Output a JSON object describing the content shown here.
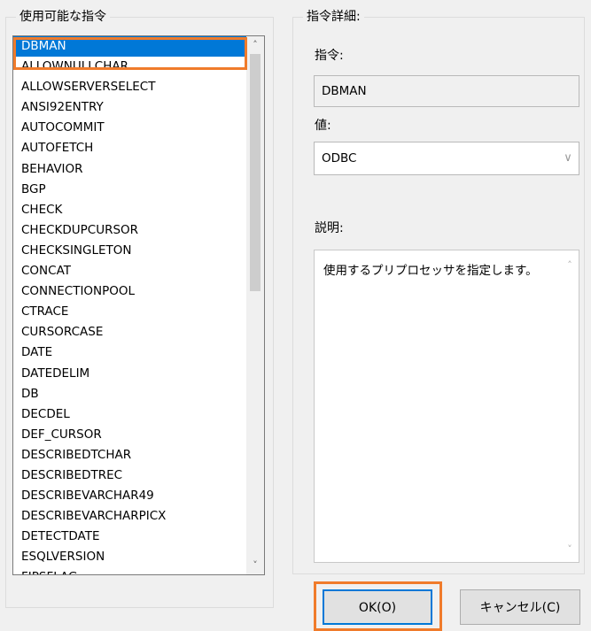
{
  "left_group": {
    "title": "使用可能な指令",
    "items": [
      "DBMAN",
      "ALLOWNULLCHAR",
      "ALLOWSERVERSELECT",
      "ANSI92ENTRY",
      "AUTOCOMMIT",
      "AUTOFETCH",
      "BEHAVIOR",
      "BGP",
      "CHECK",
      "CHECKDUPCURSOR",
      "CHECKSINGLETON",
      "CONCAT",
      "CONNECTIONPOOL",
      "CTRACE",
      "CURSORCASE",
      "DATE",
      "DATEDELIM",
      "DB",
      "DECDEL",
      "DEF_CURSOR",
      "DESCRIBEDTCHAR",
      "DESCRIBEDTREC",
      "DESCRIBEVARCHAR49",
      "DESCRIBEVARCHARPICX",
      "DETECTDATE",
      "ESQLVERSION",
      "FIPSFLAG"
    ],
    "scroll_up_icon": "chevron-up-icon",
    "scroll_down_icon": "chevron-down-icon"
  },
  "right_group": {
    "title": "指令詳細:",
    "directive_label": "指令:",
    "directive_value": "DBMAN",
    "value_label": "値:",
    "value_selected": "ODBC",
    "description_label": "説明:",
    "description_text": "使用するプリプロセッサを指定します。"
  },
  "buttons": {
    "ok": "OK(O)",
    "cancel": "キャンセル(C)"
  },
  "colors": {
    "selection": "#0078d7",
    "highlight_outline": "#f07b2b",
    "default_button_border": "#0078d7"
  }
}
